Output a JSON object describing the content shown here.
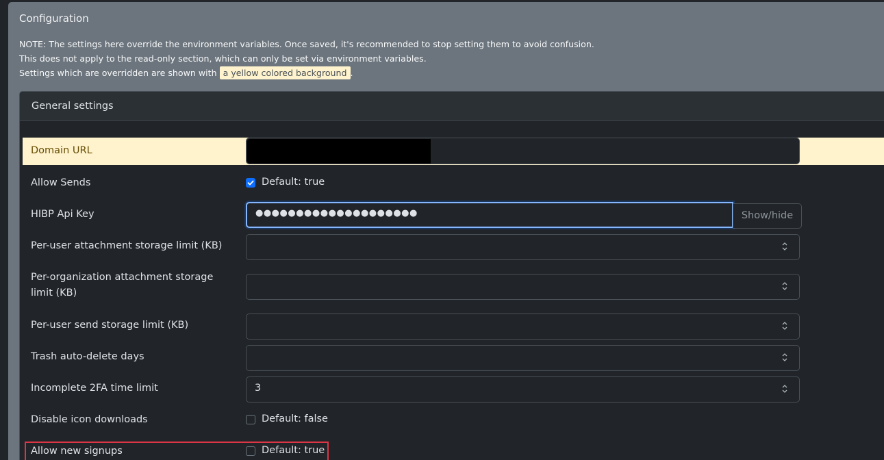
{
  "page": {
    "title": "Configuration",
    "notes": {
      "line1": "NOTE: The settings here override the environment variables. Once saved, it's recommended to stop setting them to avoid confusion.",
      "line2": "This does not apply to the read-only section, which can only be set via environment variables.",
      "line3_prefix": "Settings which are overridden are shown with",
      "line3_highlight": "a yellow colored background",
      "line3_suffix": "."
    }
  },
  "section": {
    "title": "General settings",
    "fields": {
      "domain_url": {
        "label": "Domain URL",
        "value": ""
      },
      "allow_sends": {
        "label": "Allow Sends",
        "checked": true,
        "hint": "Default: true"
      },
      "hibp_api_key": {
        "label": "HIBP Api Key",
        "value": "●●●●●●●●●●●●●●●●●●●●",
        "toggle_label": "Show/hide"
      },
      "user_attachment_limit": {
        "label": "Per-user attachment storage limit (KB)",
        "value": ""
      },
      "org_attachment_limit": {
        "label_line1": "Per-organization attachment storage",
        "label_line2": "limit (KB)",
        "value": ""
      },
      "user_send_limit": {
        "label": "Per-user send storage limit (KB)",
        "value": ""
      },
      "trash_auto_delete": {
        "label": "Trash auto-delete days",
        "value": ""
      },
      "incomplete_2fa_limit": {
        "label": "Incomplete 2FA time limit",
        "value": "3"
      },
      "disable_icon_downloads": {
        "label": "Disable icon downloads",
        "checked": false,
        "hint": "Default: false"
      },
      "allow_new_signups": {
        "label": "Allow new signups",
        "checked": false,
        "hint": "Default: true"
      }
    }
  },
  "colors": {
    "override_background": "#fff3cd",
    "focus_border": "#86b7fe",
    "checkbox_checked": "#0d6efd",
    "annotation_border": "#dc3545"
  }
}
